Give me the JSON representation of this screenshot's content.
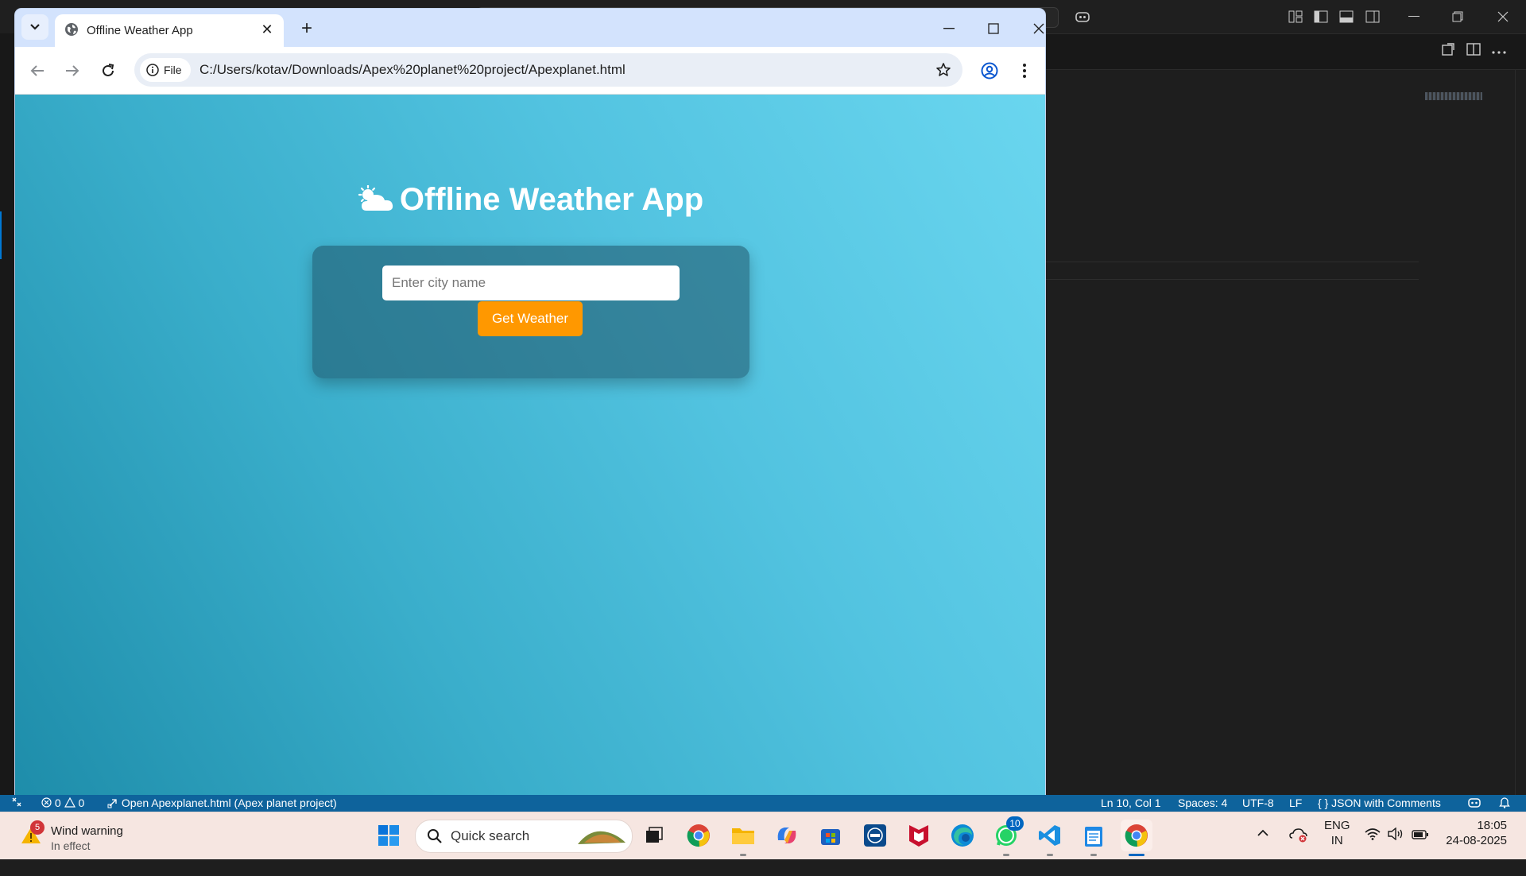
{
  "browser": {
    "tab_title": "Offline Weather App",
    "site_chip_label": "File",
    "url": "C:/Users/kotav/Downloads/Apex%20planet%20project/Apexplanet.html"
  },
  "page": {
    "title": "Offline Weather App",
    "title_icon": "sun-behind-cloud-icon",
    "input_placeholder": "Enter city name",
    "button_label": "Get Weather",
    "button_color": "#ff9800"
  },
  "statusbar": {
    "problems": "0",
    "warnings": "0",
    "open_file_msg": "Open Apexplanet.html (Apex planet project)",
    "cursor": "Ln 10, Col 1",
    "spaces": "Spaces: 4",
    "encoding": "UTF-8",
    "eol": "LF",
    "language": "JSON with Comments"
  },
  "taskbar": {
    "weather_badge": "5",
    "weather_title": "Wind warning",
    "weather_sub": "In effect",
    "search_label": "Quick search",
    "whatsapp_badge": "10",
    "lang_1": "ENG",
    "lang_2": "IN",
    "time": "18:05",
    "date": "24-08-2025"
  }
}
